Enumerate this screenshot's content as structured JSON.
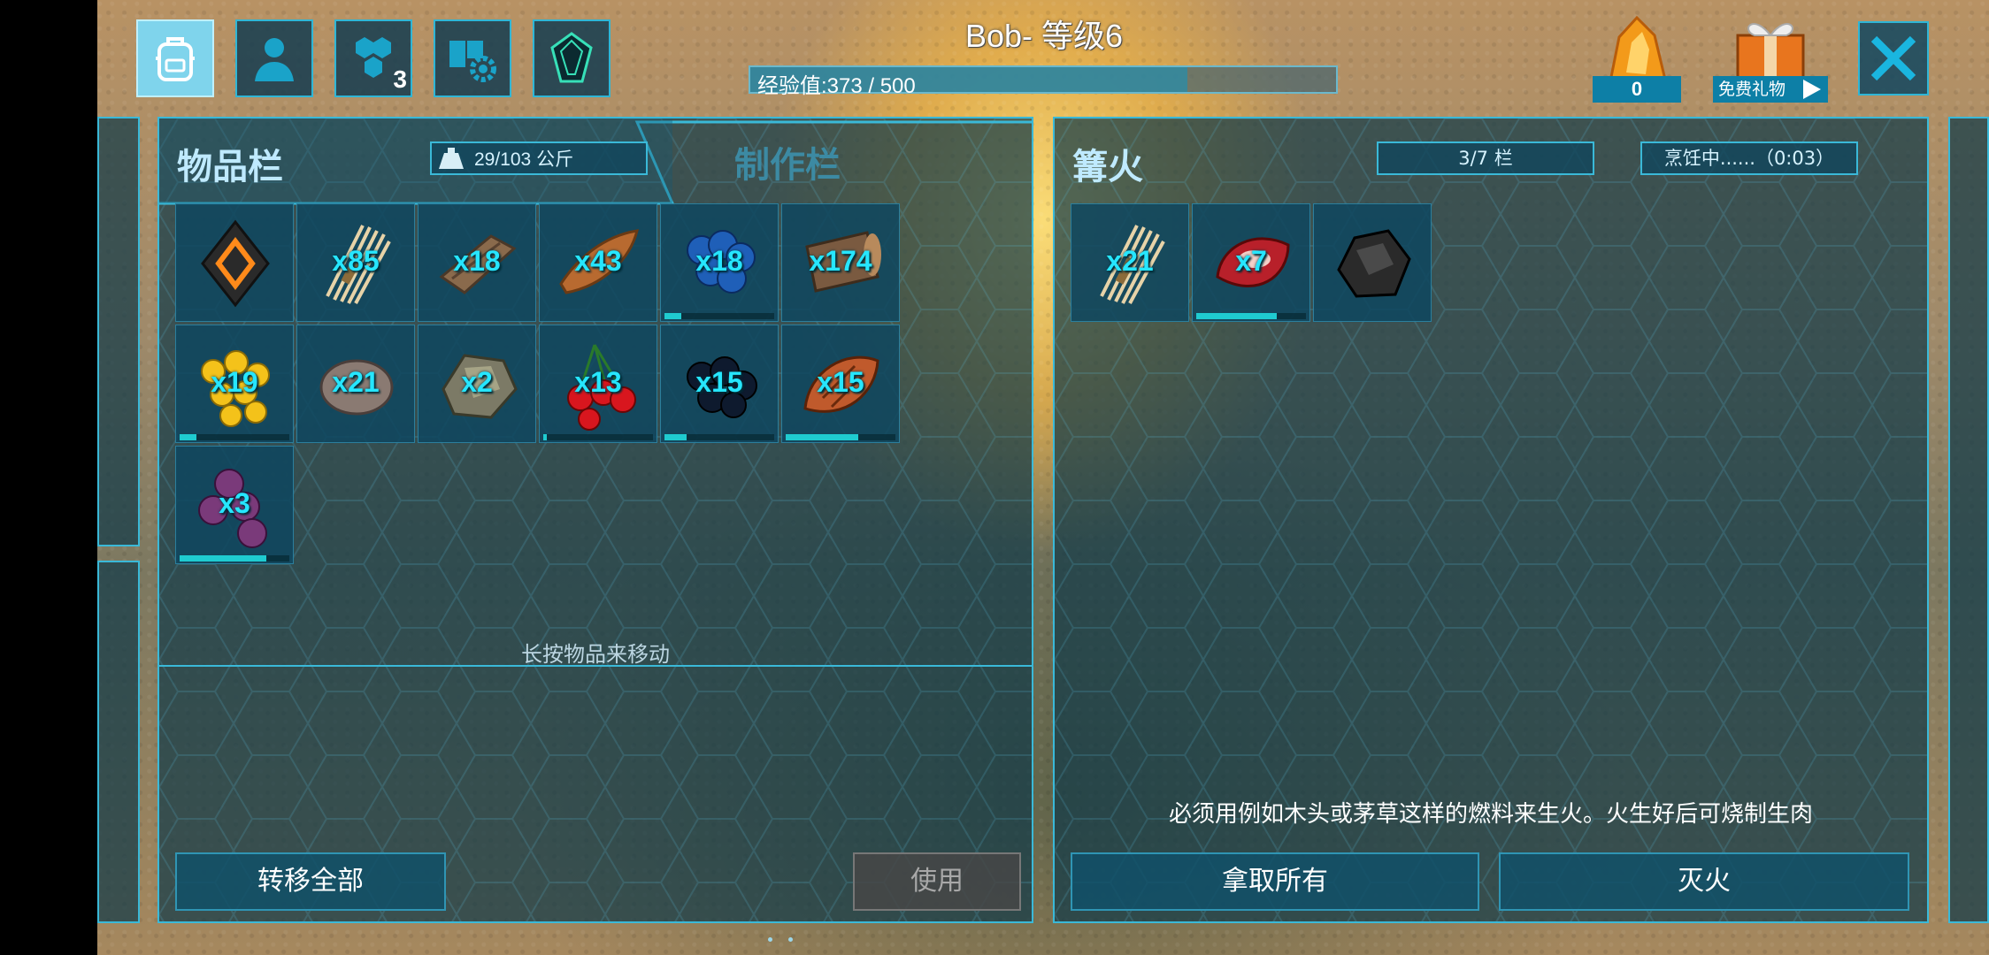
{
  "header": {
    "player_name": "Bob- 等级6",
    "xp_label": "经验值:373 / 500",
    "xp_progress": 0.746,
    "tabs": [
      {
        "name": "inventory",
        "icon": "backpack-icon",
        "active": true
      },
      {
        "name": "character",
        "icon": "person-icon"
      },
      {
        "name": "engrams",
        "icon": "hexagons-icon",
        "badge": "3"
      },
      {
        "name": "settings",
        "icon": "book-gear-icon"
      },
      {
        "name": "tribe",
        "icon": "crystal-icon"
      }
    ],
    "amber_count": "0",
    "gift_label": "免费礼物"
  },
  "inventory": {
    "title": "物品栏",
    "crafting_tab": "制作栏",
    "weight": "29/103 公斤",
    "hint": "长按物品来移动",
    "transfer_all": "转移全部",
    "use": "使用",
    "items": [
      {
        "icon": "implant-icon",
        "qty": "",
        "spoil": null
      },
      {
        "icon": "thatch-icon",
        "qty": "x85",
        "spoil": null
      },
      {
        "icon": "wood-icon",
        "qty": "x18",
        "spoil": null
      },
      {
        "icon": "fiber-wood-icon",
        "qty": "x43",
        "spoil": null
      },
      {
        "icon": "blue-berry-icon",
        "qty": "x18",
        "spoil": 0.15
      },
      {
        "icon": "log-icon",
        "qty": "x174",
        "spoil": null
      },
      {
        "icon": "yellow-berry-icon",
        "qty": "x19",
        "spoil": 0.15
      },
      {
        "icon": "stone-icon",
        "qty": "x21",
        "spoil": null
      },
      {
        "icon": "flint-icon",
        "qty": "x2",
        "spoil": null
      },
      {
        "icon": "red-berry-icon",
        "qty": "x13",
        "spoil": 0.02
      },
      {
        "icon": "black-berry-icon",
        "qty": "x15",
        "spoil": 0.2
      },
      {
        "icon": "cooked-meat-icon",
        "qty": "x15",
        "spoil": 0.65
      },
      {
        "icon": "purple-berry-icon",
        "qty": "x3",
        "spoil": 0.78
      }
    ]
  },
  "campfire": {
    "title": "篝火",
    "slots": "3/7 栏",
    "cooking": "烹饪中......（0:03）",
    "note": "必须用例如木头或茅草这样的燃料来生火。火生好后可烧制生肉",
    "take_all": "拿取所有",
    "extinguish": "灭火",
    "items": [
      {
        "icon": "thatch-icon",
        "qty": "x21",
        "spoil": null
      },
      {
        "icon": "raw-meat-icon",
        "qty": "x7",
        "spoil": 0.72
      },
      {
        "icon": "charcoal-icon",
        "qty": "",
        "spoil": null
      }
    ]
  },
  "colors": {
    "accent": "#3ab9d8",
    "qty_text": "#26e6ff",
    "panel_bg": "#123a48"
  }
}
